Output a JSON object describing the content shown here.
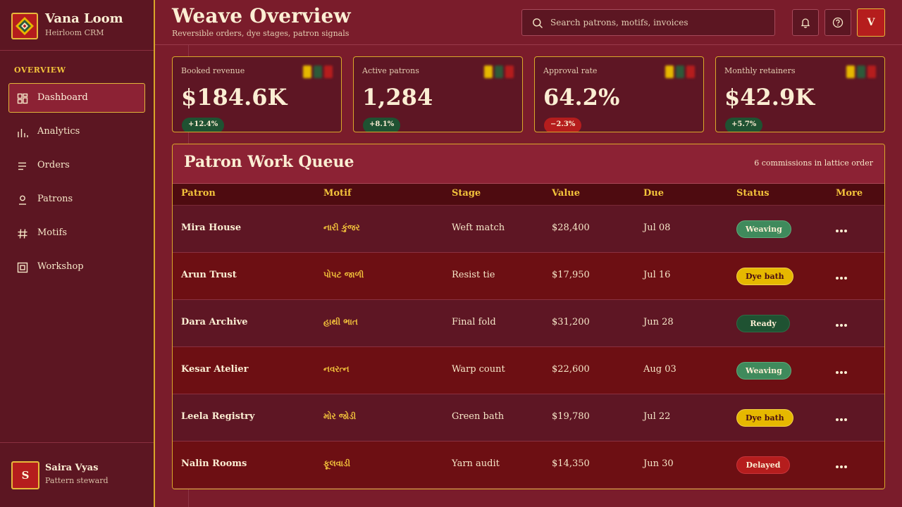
{
  "brand": {
    "name": "Vana Loom",
    "subtitle": "Heirloom CRM",
    "logo_icon": "diamond-lattice-icon"
  },
  "sidebar": {
    "section_label": "OVERVIEW",
    "items": [
      {
        "label": "Dashboard",
        "icon": "dashboard-grid-icon",
        "active": true
      },
      {
        "label": "Analytics",
        "icon": "bar-chart-icon",
        "active": false
      },
      {
        "label": "Orders",
        "icon": "list-icon",
        "active": false
      },
      {
        "label": "Patrons",
        "icon": "user-icon",
        "active": false
      },
      {
        "label": "Motifs",
        "icon": "hash-icon",
        "active": false
      },
      {
        "label": "Workshop",
        "icon": "frame-icon",
        "active": false
      }
    ],
    "user": {
      "initial": "S",
      "name": "Saira Vyas",
      "role": "Pattern steward"
    }
  },
  "header": {
    "title": "Weave Overview",
    "subtitle": "Reversible orders, dye stages, patron signals",
    "search_placeholder": "Search patrons, motifs, invoices",
    "search_value": "",
    "profile_initial": "V"
  },
  "kpis": [
    {
      "label": "Booked revenue",
      "value": "$184.6K",
      "delta": "+12.4%",
      "trend": "up"
    },
    {
      "label": "Active patrons",
      "value": "1,284",
      "delta": "+8.1%",
      "trend": "up"
    },
    {
      "label": "Approval rate",
      "value": "64.2%",
      "delta": "−2.3%",
      "trend": "down"
    },
    {
      "label": "Monthly retainers",
      "value": "$42.9K",
      "delta": "+5.7%",
      "trend": "up"
    }
  ],
  "queue": {
    "title": "Patron Work Queue",
    "meta": "6 commissions in lattice order",
    "columns": [
      "Patron",
      "Motif",
      "Stage",
      "Value",
      "Due",
      "Status",
      "More"
    ],
    "rows": [
      {
        "patron": "Mira House",
        "motif": "નારી કુંજર",
        "stage": "Weft match",
        "value": "$28,400",
        "due": "Jul 08",
        "status": "Weaving"
      },
      {
        "patron": "Arun Trust",
        "motif": "પોપટ જાળી",
        "stage": "Resist tie",
        "value": "$17,950",
        "due": "Jul 16",
        "status": "Dye bath"
      },
      {
        "patron": "Dara Archive",
        "motif": "હાથી ભાત",
        "stage": "Final fold",
        "value": "$31,200",
        "due": "Jun 28",
        "status": "Ready"
      },
      {
        "patron": "Kesar Atelier",
        "motif": "નવરત્ન",
        "stage": "Warp count",
        "value": "$22,600",
        "due": "Aug 03",
        "status": "Weaving"
      },
      {
        "patron": "Leela Registry",
        "motif": "મોર જોડી",
        "stage": "Green bath",
        "value": "$19,780",
        "due": "Jul 22",
        "status": "Dye bath"
      },
      {
        "patron": "Nalin Rooms",
        "motif": "ફૂલવાડી",
        "stage": "Yarn audit",
        "value": "$14,350",
        "due": "Jun 30",
        "status": "Delayed"
      }
    ]
  },
  "colors": {
    "background": "#7a1c2b",
    "sidebar": "#5c1622",
    "accent_gold": "#d9a92a",
    "accent_yellow": "#f2c23b",
    "swatch_yellow": "#e6b800",
    "swatch_green": "#2d5a3a",
    "swatch_red": "#b51d1d",
    "status_weaving": "#3f8a5c",
    "status_dye_bath": "#e6b800",
    "status_ready": "#1f5232",
    "status_delayed": "#b51d1d"
  }
}
